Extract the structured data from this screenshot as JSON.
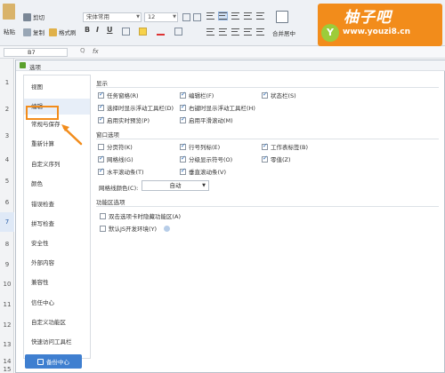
{
  "ribbon": {
    "cut_label": "剪切",
    "copy_label": "复制",
    "format_painter_label": "格式刷",
    "paste_label": "粘贴",
    "font_name": "宋体常用",
    "font_size": "12",
    "merge_label": "合并居中",
    "bold": "B",
    "italic": "I",
    "underline": "U"
  },
  "watermark": {
    "title": "柚子吧",
    "url": "www.youzi8.cn",
    "badge": "Y",
    "colors": {
      "orange": "#f28c1b",
      "green": "#9ccc3a"
    }
  },
  "formula_bar": {
    "cell_ref": "B7",
    "fx_label": "fx",
    "zoom_label": "Q"
  },
  "row_headers": [
    "1",
    "2",
    "3",
    "4",
    "5",
    "6",
    "7",
    "8",
    "9",
    "10",
    "11",
    "12",
    "13",
    "14",
    "15"
  ],
  "selected_row": "7",
  "dialog": {
    "title": "选项",
    "nav_items": [
      "视图",
      "编辑",
      "常规与保存",
      "重新计算",
      "自定义序列",
      "颜色",
      "错误检查",
      "拼写检查",
      "安全性",
      "外部内容",
      "兼容性",
      "信任中心",
      "自定义功能区",
      "快速访问工具栏"
    ],
    "active_nav": "编辑",
    "backup_button": "备份中心",
    "sections": {
      "display": {
        "title": "显示",
        "options": [
          {
            "label": "任务窗格(R)",
            "checked": true
          },
          {
            "label": "编辑栏(F)",
            "checked": true
          },
          {
            "label": "状态栏(S)",
            "checked": true
          },
          {
            "label": "选择时显示浮动工具栏(D)",
            "checked": true
          },
          {
            "label": "右键时显示浮动工具栏(H)",
            "checked": true
          },
          {
            "label": "启用实时预览(P)",
            "checked": true
          },
          {
            "label": "启用平滑滚动(M)",
            "checked": true
          }
        ]
      },
      "window": {
        "title": "窗口选项",
        "options": [
          {
            "label": "分页符(K)",
            "checked": false
          },
          {
            "label": "行号列标(E)",
            "checked": true
          },
          {
            "label": "工作表标签(B)",
            "checked": true
          },
          {
            "label": "网格线(G)",
            "checked": true
          },
          {
            "label": "分级显示符号(O)",
            "checked": true
          },
          {
            "label": "零值(Z)",
            "checked": true
          },
          {
            "label": "水平滚动条(T)",
            "checked": true
          },
          {
            "label": "垂直滚动条(V)",
            "checked": true
          }
        ],
        "gridcolor_label": "网格线颜色(C):",
        "gridcolor_value": "自动"
      },
      "ribbon_options": {
        "title": "功能区选项",
        "options": [
          {
            "label": "双击选项卡时隐藏功能区(A)",
            "checked": false
          },
          {
            "label": "默认JS开发环境(Y)",
            "checked": false
          }
        ]
      }
    }
  }
}
